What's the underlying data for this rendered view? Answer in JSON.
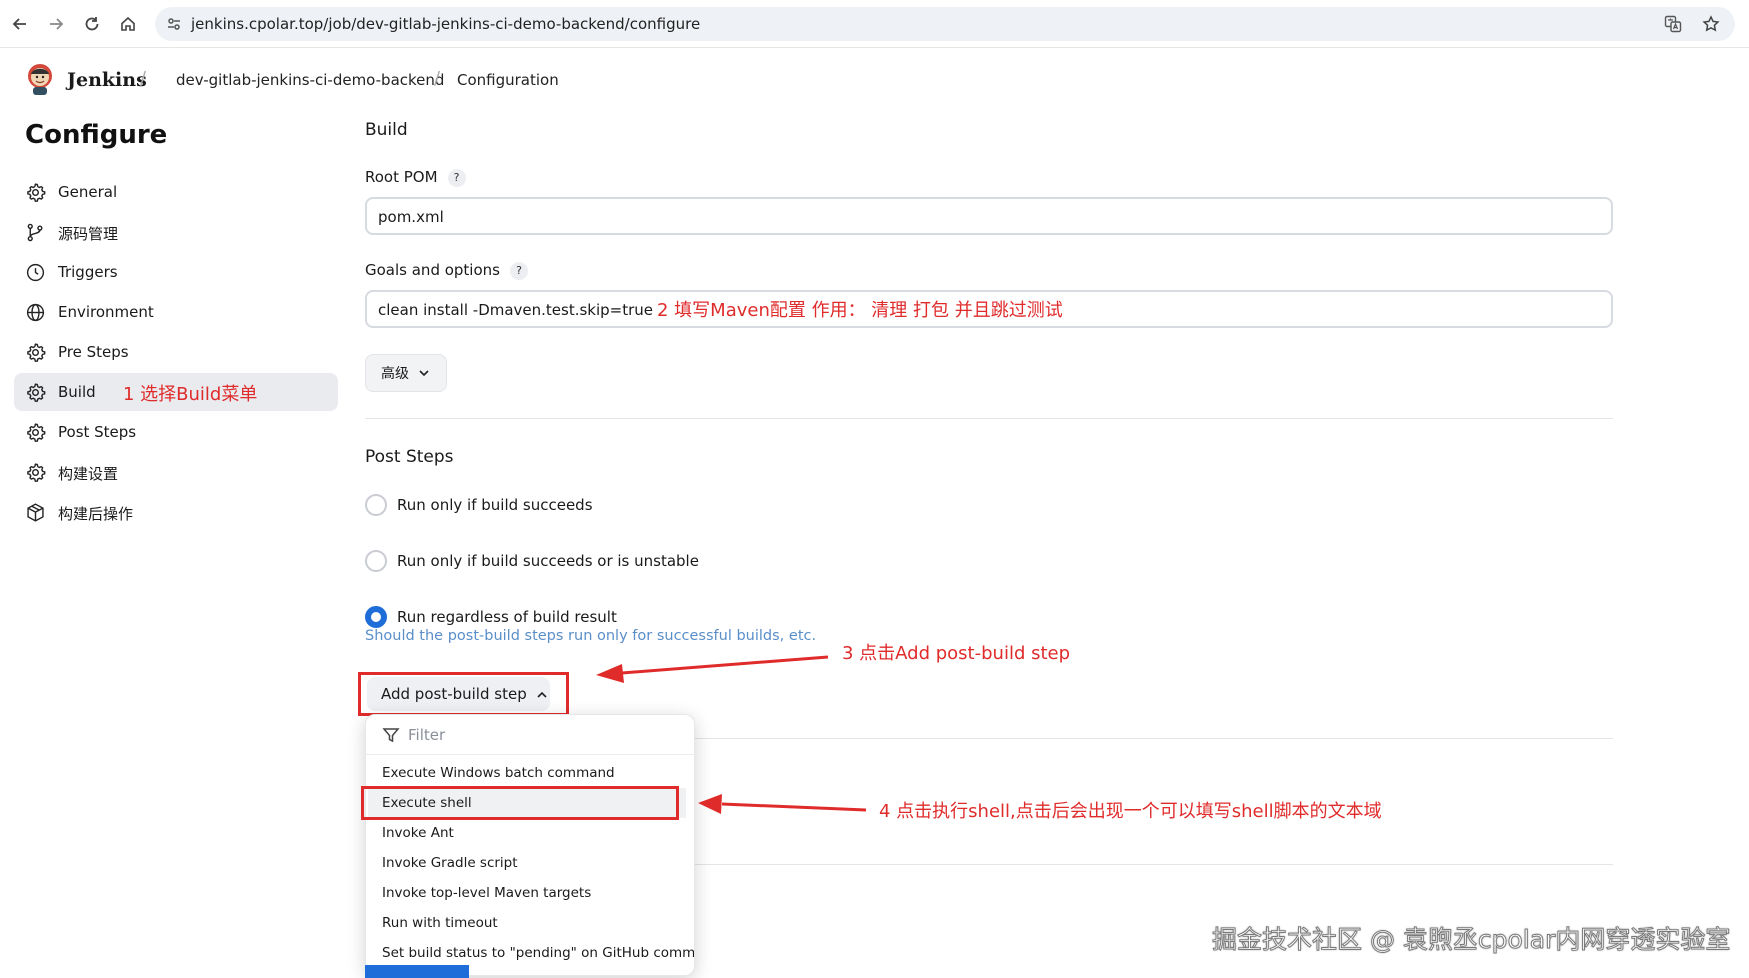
{
  "browser": {
    "url": "jenkins.cpolar.top/job/dev-gitlab-jenkins-ci-demo-backend/configure"
  },
  "header": {
    "brand": "Jenkins",
    "breadcrumbs": [
      "dev-gitlab-jenkins-ci-demo-backend",
      "Configuration"
    ]
  },
  "sidebar": {
    "title": "Configure",
    "items": [
      {
        "label": "General",
        "icon": "gear-icon"
      },
      {
        "label": "源码管理",
        "icon": "branch-icon"
      },
      {
        "label": "Triggers",
        "icon": "clock-icon"
      },
      {
        "label": "Environment",
        "icon": "globe-icon"
      },
      {
        "label": "Pre Steps",
        "icon": "gear-icon"
      },
      {
        "label": "Build",
        "icon": "gear-icon",
        "active": true
      },
      {
        "label": "Post Steps",
        "icon": "gear-icon"
      },
      {
        "label": "构建设置",
        "icon": "gear-icon"
      },
      {
        "label": "构建后操作",
        "icon": "package-icon"
      }
    ]
  },
  "build": {
    "section_title": "Build",
    "root_pom_label": "Root POM",
    "root_pom_value": "pom.xml",
    "goals_label": "Goals and options",
    "goals_value": "clean install -Dmaven.test.skip=true",
    "help_glyph": "?",
    "advanced_label": "高级"
  },
  "post_steps": {
    "section_title": "Post Steps",
    "options": [
      {
        "label": "Run only if build succeeds",
        "checked": false
      },
      {
        "label": "Run only if build succeeds or is unstable",
        "checked": false
      },
      {
        "label": "Run regardless of build result",
        "checked": true
      }
    ],
    "hint": "Should the post-build steps run only for successful builds, etc.",
    "add_button_label": "Add post-build step"
  },
  "dropdown": {
    "filter_placeholder": "Filter",
    "items": [
      "Execute Windows batch command",
      "Execute shell",
      "Invoke Ant",
      "Invoke Gradle script",
      "Invoke top-level Maven targets",
      "Run with timeout",
      "Set build status to \"pending\" on GitHub commit"
    ]
  },
  "annotations": {
    "a1": "1 选择Build菜单",
    "a2": "2 填写Maven配置  作用：  清理 打包 并且跳过测试",
    "a3": "3 点击Add post-build step",
    "a4": "4 点击执行shell,点击后会出现一个可以填写shell脚本的文本域"
  },
  "watermark": "掘金技术社区 @ 袁煦丞cpolar内网穿透实验室",
  "colors": {
    "accent": "#1e6dd8",
    "annotation_red": "#e02b2b",
    "active_item_bg": "#e9ebef",
    "hint_text": "#5a8ec9"
  }
}
